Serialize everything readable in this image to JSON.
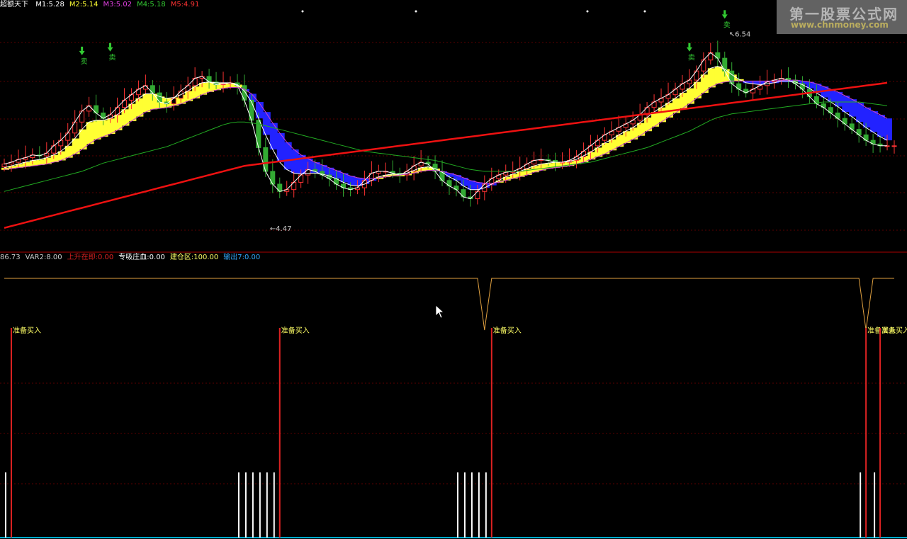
{
  "header": {
    "indicator_name": "超额天下",
    "legend": [
      {
        "label": "M1:5.28",
        "color": "#ffffff"
      },
      {
        "label": "M2:5.14",
        "color": "#ffff33"
      },
      {
        "label": "M3:5.02",
        "color": "#e040e0"
      },
      {
        "label": "M4:5.18",
        "color": "#33cc33"
      },
      {
        "label": "M5:4.91",
        "color": "#ff3333"
      }
    ]
  },
  "sub_header": {
    "legend": [
      {
        "label": "86.73",
        "color": "#cccccc"
      },
      {
        "label": "VAR2:8.00",
        "color": "#cccccc"
      },
      {
        "label": "上升在即:0.00",
        "color": "#dd2222"
      },
      {
        "label": "专吸庄血:0.00",
        "color": "#ffffff"
      },
      {
        "label": "建仓区:100.00",
        "color": "#ffff66"
      },
      {
        "label": "输出7:0.00",
        "color": "#33aaff"
      }
    ]
  },
  "watermark": {
    "line1": "第一股票公式网",
    "line2": "www.chnmoney.com"
  },
  "colors": {
    "background": "#000000",
    "up_candle": "#ff3333",
    "down_candle": "#33aa33",
    "ma_white": "#ffffff",
    "ma_magenta": "#cc44cc",
    "ma_green": "#22aa22",
    "ma_red": "#ee1111",
    "band_yellow": "#ffff33",
    "band_blue": "#2222ff",
    "signal_orange": "#e0a040",
    "signal_red": "#dd2222",
    "separator": "#aa0000"
  },
  "chart_data": [
    {
      "type": "line",
      "panel": "price",
      "ylim": [
        4.2,
        6.8
      ],
      "x": [
        0,
        1,
        2,
        3,
        4,
        5,
        6,
        7,
        8,
        9,
        10,
        11,
        12,
        13,
        14,
        15,
        16,
        17,
        18,
        19,
        20,
        21,
        22,
        23,
        24,
        25,
        26,
        27,
        28,
        29,
        30,
        31,
        32,
        33,
        34,
        35,
        36,
        37,
        38,
        39,
        40,
        41,
        42,
        43,
        44,
        45,
        46,
        47,
        48,
        49,
        50,
        51,
        52,
        53,
        54,
        55,
        56,
        57,
        58,
        59,
        60,
        61,
        62,
        63,
        64,
        65,
        66,
        67,
        68,
        69,
        70,
        71,
        72,
        73,
        74,
        75,
        76,
        77,
        78,
        79,
        80,
        81,
        82,
        83,
        84,
        85,
        86,
        87,
        88,
        89,
        90,
        91,
        92,
        93,
        94,
        95,
        96,
        97,
        98,
        99,
        100,
        101,
        102,
        103,
        104,
        105,
        106,
        107,
        108,
        109,
        110,
        111,
        112,
        113,
        114,
        115,
        116,
        117,
        118,
        119,
        120,
        121,
        122,
        123,
        124,
        125,
        126
      ],
      "series": [
        {
          "name": "M1",
          "color": "#ffffff",
          "values": [
            5.08,
            5.1,
            5.13,
            5.15,
            5.18,
            5.17,
            5.2,
            5.28,
            5.34,
            5.42,
            5.54,
            5.66,
            5.72,
            5.64,
            5.58,
            5.62,
            5.7,
            5.78,
            5.84,
            5.9,
            5.94,
            5.86,
            5.76,
            5.74,
            5.8,
            5.88,
            5.94,
            6.02,
            6.04,
            5.98,
            5.95,
            5.96,
            5.97,
            5.94,
            5.78,
            5.56,
            5.26,
            5.0,
            4.86,
            4.78,
            4.8,
            4.88,
            4.96,
            5.02,
            5.0,
            4.96,
            4.92,
            4.86,
            4.82,
            4.8,
            4.82,
            4.9,
            4.98,
            5.0,
            5.0,
            4.98,
            4.96,
            5.0,
            5.06,
            5.1,
            5.08,
            5.0,
            4.9,
            4.84,
            4.8,
            4.72,
            4.7,
            4.78,
            4.86,
            4.92,
            4.96,
            4.99,
            5.0,
            5.03,
            5.08,
            5.12,
            5.13,
            5.12,
            5.1,
            5.1,
            5.12,
            5.16,
            5.22,
            5.28,
            5.34,
            5.4,
            5.44,
            5.48,
            5.52,
            5.56,
            5.62,
            5.7,
            5.76,
            5.8,
            5.84,
            5.9,
            5.96,
            6.0,
            6.1,
            6.22,
            6.3,
            6.24,
            6.1,
            5.96,
            5.9,
            5.86,
            5.9,
            5.94,
            5.98,
            6.0,
            6.02,
            6.0,
            5.96,
            5.9,
            5.82,
            5.74,
            5.7,
            5.64,
            5.58,
            5.52,
            5.46,
            5.4,
            5.34,
            5.3,
            5.28,
            5.28,
            5.28
          ]
        },
        {
          "name": "M2",
          "color": "#ffff33",
          "values": [
            5.04,
            5.06,
            5.08,
            5.1,
            5.12,
            5.13,
            5.15,
            5.18,
            5.22,
            5.28,
            5.36,
            5.46,
            5.54,
            5.56,
            5.56,
            5.58,
            5.62,
            5.68,
            5.74,
            5.8,
            5.85,
            5.85,
            5.82,
            5.8,
            5.81,
            5.84,
            5.88,
            5.93,
            5.97,
            5.98,
            5.97,
            5.97,
            5.97,
            5.95,
            5.88,
            5.76,
            5.58,
            5.4,
            5.24,
            5.1,
            5.02,
            4.98,
            4.97,
            4.98,
            4.98,
            4.97,
            4.95,
            4.92,
            4.88,
            4.85,
            4.84,
            4.86,
            4.9,
            4.94,
            4.96,
            4.97,
            4.97,
            4.98,
            5.01,
            5.04,
            5.05,
            5.03,
            4.99,
            4.94,
            4.9,
            4.84,
            4.8,
            4.8,
            4.82,
            4.86,
            4.9,
            4.94,
            4.97,
            5.0,
            5.03,
            5.06,
            5.08,
            5.09,
            5.1,
            5.1,
            5.11,
            5.13,
            5.17,
            5.21,
            5.26,
            5.31,
            5.35,
            5.4,
            5.44,
            5.48,
            5.53,
            5.59,
            5.65,
            5.7,
            5.75,
            5.8,
            5.86,
            5.91,
            5.98,
            6.06,
            6.13,
            6.15,
            6.12,
            6.06,
            6.01,
            5.97,
            5.96,
            5.95,
            5.96,
            5.97,
            5.99,
            5.99,
            5.98,
            5.95,
            5.91,
            5.86,
            5.81,
            5.76,
            5.71,
            5.65,
            5.6,
            5.54,
            5.48,
            5.43,
            5.38,
            5.34,
            5.14
          ]
        },
        {
          "name": "M3",
          "color": "#cc44cc",
          "values": [
            5.02,
            5.03,
            5.04,
            5.05,
            5.06,
            5.07,
            5.08,
            5.1,
            5.12,
            5.15,
            5.19,
            5.24,
            5.3,
            5.35,
            5.38,
            5.41,
            5.45,
            5.5,
            5.55,
            5.6,
            5.65,
            5.68,
            5.69,
            5.7,
            5.72,
            5.74,
            5.77,
            5.8,
            5.84,
            5.87,
            5.89,
            5.91,
            5.92,
            5.92,
            5.9,
            5.85,
            5.76,
            5.65,
            5.53,
            5.42,
            5.32,
            5.24,
            5.18,
            5.14,
            5.1,
            5.07,
            5.04,
            5.01,
            4.98,
            4.95,
            4.93,
            4.92,
            4.92,
            4.93,
            4.94,
            4.95,
            4.96,
            4.97,
            4.98,
            5.0,
            5.01,
            5.01,
            5.0,
            4.98,
            4.96,
            4.93,
            4.9,
            4.88,
            4.87,
            4.87,
            4.88,
            4.9,
            4.92,
            4.94,
            4.96,
            4.99,
            5.01,
            5.03,
            5.04,
            5.05,
            5.06,
            5.08,
            5.1,
            5.13,
            5.16,
            5.19,
            5.23,
            5.27,
            5.31,
            5.35,
            5.39,
            5.44,
            5.49,
            5.54,
            5.59,
            5.64,
            5.69,
            5.74,
            5.8,
            5.86,
            5.92,
            5.96,
            5.98,
            5.99,
            5.99,
            5.99,
            5.99,
            5.99,
            5.99,
            5.99,
            6.0,
            6.0,
            6.0,
            5.99,
            5.98,
            5.96,
            5.93,
            5.9,
            5.87,
            5.83,
            5.79,
            5.75,
            5.7,
            5.66,
            5.62,
            5.58,
            5.02
          ]
        },
        {
          "name": "M4",
          "color": "#22aa22",
          "values": [
            4.78,
            4.8,
            4.82,
            4.84,
            4.86,
            4.88,
            4.9,
            4.92,
            4.94,
            4.96,
            4.98,
            5.0,
            5.03,
            5.06,
            5.09,
            5.11,
            5.13,
            5.15,
            5.17,
            5.19,
            5.21,
            5.23,
            5.25,
            5.27,
            5.3,
            5.33,
            5.36,
            5.39,
            5.42,
            5.45,
            5.48,
            5.51,
            5.53,
            5.54,
            5.54,
            5.53,
            5.52,
            5.5,
            5.48,
            5.46,
            5.44,
            5.42,
            5.4,
            5.38,
            5.36,
            5.34,
            5.32,
            5.3,
            5.28,
            5.26,
            5.24,
            5.22,
            5.21,
            5.2,
            5.19,
            5.18,
            5.17,
            5.16,
            5.15,
            5.14,
            5.13,
            5.12,
            5.1,
            5.08,
            5.06,
            5.04,
            5.02,
            5.01,
            5.0,
            5.0,
            5.0,
            5.0,
            5.0,
            5.0,
            5.01,
            5.02,
            5.03,
            5.04,
            5.05,
            5.06,
            5.07,
            5.08,
            5.09,
            5.1,
            5.12,
            5.14,
            5.16,
            5.18,
            5.2,
            5.22,
            5.24,
            5.26,
            5.29,
            5.32,
            5.35,
            5.38,
            5.41,
            5.44,
            5.48,
            5.52,
            5.56,
            5.59,
            5.61,
            5.63,
            5.64,
            5.65,
            5.66,
            5.67,
            5.68,
            5.69,
            5.7,
            5.71,
            5.72,
            5.73,
            5.74,
            5.75,
            5.76,
            5.76,
            5.76,
            5.76,
            5.76,
            5.76,
            5.75,
            5.74,
            5.73,
            5.72,
            5.18
          ]
        },
        {
          "name": "M5",
          "color": "#ee1111",
          "values": [
            4.38,
            4.4,
            4.42,
            4.44,
            4.46,
            4.48,
            4.5,
            4.52,
            4.54,
            4.56,
            4.58,
            4.6,
            4.62,
            4.64,
            4.66,
            4.68,
            4.7,
            4.72,
            4.74,
            4.76,
            4.78,
            4.8,
            4.82,
            4.84,
            4.86,
            4.88,
            4.9,
            4.92,
            4.94,
            4.96,
            4.98,
            5.0,
            5.02,
            5.04,
            5.06,
            5.07,
            5.08,
            5.09,
            5.1,
            5.11,
            5.12,
            5.13,
            5.14,
            5.15,
            5.16,
            5.17,
            5.18,
            5.19,
            5.2,
            5.21,
            5.22,
            5.23,
            5.24,
            5.25,
            5.26,
            5.27,
            5.28,
            5.29,
            5.3,
            5.31,
            5.32,
            5.33,
            5.34,
            5.35,
            5.36,
            5.37,
            5.38,
            5.39,
            5.4,
            5.41,
            5.42,
            5.43,
            5.44,
            5.45,
            5.46,
            5.47,
            5.48,
            5.49,
            5.5,
            5.51,
            5.52,
            5.53,
            5.54,
            5.55,
            5.56,
            5.57,
            5.58,
            5.59,
            5.6,
            5.61,
            5.62,
            5.63,
            5.64,
            5.65,
            5.66,
            5.67,
            5.68,
            5.69,
            5.7,
            5.71,
            5.72,
            5.73,
            5.74,
            5.75,
            5.76,
            5.77,
            5.78,
            5.79,
            5.8,
            5.81,
            5.82,
            5.83,
            5.84,
            5.85,
            5.86,
            5.87,
            5.88,
            5.89,
            5.9,
            5.91,
            5.92,
            5.93,
            5.94,
            5.95,
            5.96,
            5.97,
            4.91
          ]
        }
      ],
      "annotations": [
        {
          "label": "卖",
          "x": 11,
          "y": 6.18
        },
        {
          "label": "卖",
          "x": 15,
          "y": 6.22
        },
        {
          "label": "卖",
          "x": 97,
          "y": 6.22
        },
        {
          "label": "卖",
          "x": 102,
          "y": 6.58
        },
        {
          "label": "6.54",
          "x": 102,
          "y": 6.54
        },
        {
          "label": "4.47",
          "x": 37,
          "y": 4.47
        }
      ]
    },
    {
      "type": "line",
      "panel": "signal",
      "series": [
        {
          "name": "建仓区",
          "color": "#e0a040",
          "values": [
            100,
            100,
            100,
            100,
            100,
            100,
            100,
            100,
            100,
            100,
            100,
            100,
            100,
            100,
            100,
            100,
            100,
            100,
            100,
            100,
            100,
            100,
            100,
            100,
            100,
            100,
            100,
            100,
            100,
            100,
            100,
            100,
            100,
            100,
            100,
            100,
            100,
            100,
            100,
            100,
            100,
            100,
            100,
            100,
            100,
            100,
            100,
            100,
            100,
            100,
            100,
            100,
            100,
            100,
            100,
            100,
            100,
            100,
            100,
            100,
            100,
            100,
            100,
            100,
            100,
            100,
            100,
            100,
            0,
            100,
            100,
            100,
            100,
            100,
            100,
            100,
            100,
            100,
            100,
            100,
            100,
            100,
            100,
            100,
            100,
            100,
            100,
            100,
            100,
            100,
            100,
            100,
            100,
            100,
            100,
            100,
            100,
            100,
            100,
            100,
            100,
            100,
            100,
            100,
            100,
            100,
            100,
            100,
            100,
            100,
            100,
            100,
            100,
            100,
            100,
            100,
            100,
            100,
            100,
            100,
            100,
            100,
            0,
            100,
            100,
            100,
            100
          ]
        }
      ],
      "labels": [
        {
          "label": "准备买入",
          "x": 1
        },
        {
          "label": "准备买入",
          "x": 39
        },
        {
          "label": "准备买入",
          "x": 69
        },
        {
          "label": "准备买入",
          "x": 122
        },
        {
          "label": "准备买入",
          "x": 124
        }
      ],
      "white_bars_x": [
        0,
        33,
        34,
        35,
        36,
        37,
        38,
        64,
        65,
        66,
        67,
        68,
        121,
        123
      ]
    }
  ]
}
